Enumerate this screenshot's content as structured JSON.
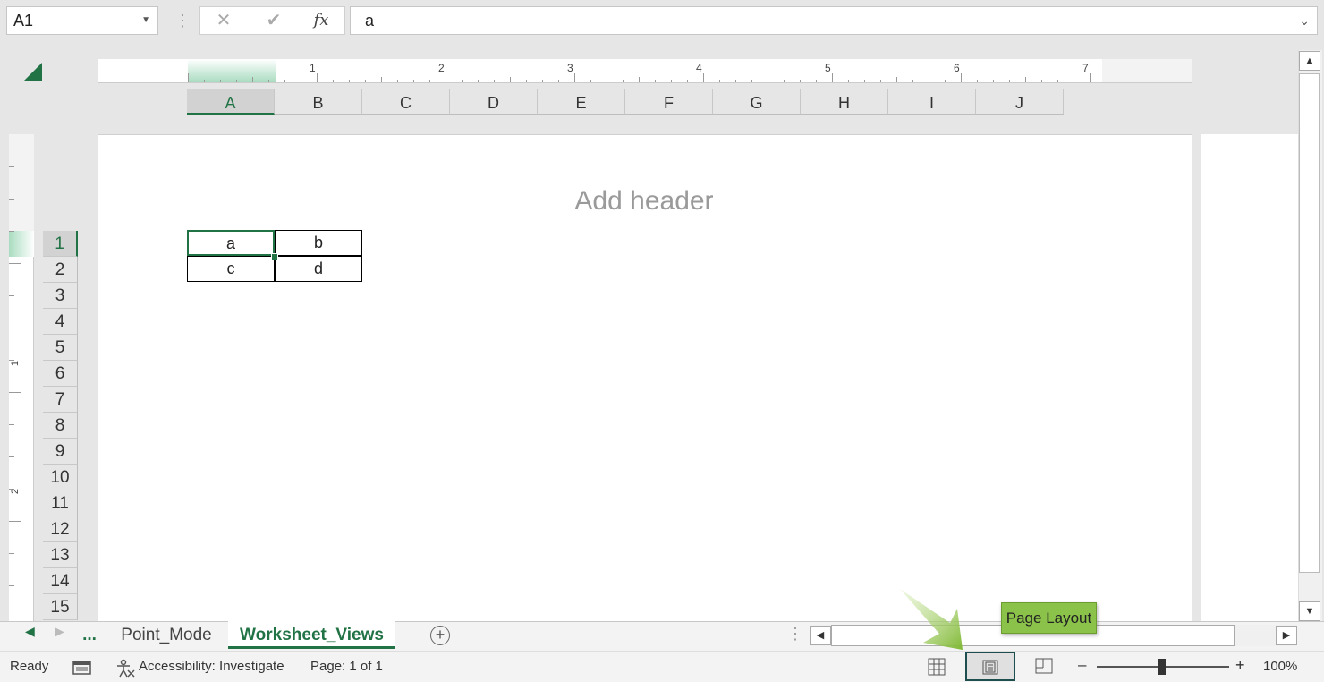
{
  "formula_bar": {
    "name_box": "A1",
    "formula_value": "a",
    "cancel_glyph": "✕",
    "enter_glyph": "✔",
    "fx_glyph": "fx"
  },
  "ruler": {
    "top_numbers": [
      "1",
      "2",
      "3",
      "4",
      "5",
      "6",
      "7"
    ],
    "left_numbers": [
      "1",
      "2"
    ]
  },
  "columns": [
    "A",
    "B",
    "C",
    "D",
    "E",
    "F",
    "G",
    "H",
    "I",
    "J"
  ],
  "rows": [
    "1",
    "2",
    "3",
    "4",
    "5",
    "6",
    "7",
    "8",
    "9",
    "10",
    "11",
    "12",
    "13",
    "14",
    "15"
  ],
  "page": {
    "header_placeholder": "Add header"
  },
  "cells": {
    "A1": "a",
    "B1": "b",
    "A2": "c",
    "B2": "d"
  },
  "sheet_tabs": {
    "ellipsis": "...",
    "tabs": [
      "Point_Mode",
      "Worksheet_Views"
    ],
    "active": "Worksheet_Views",
    "add_glyph": "+"
  },
  "status_bar": {
    "ready": "Ready",
    "accessibility": "Accessibility: Investigate",
    "page": "Page: 1 of 1",
    "zoom": "100%",
    "zoom_minus": "–",
    "zoom_plus": "+",
    "zoom_level_percent": 100
  },
  "tooltip": {
    "label": "Page Layout"
  },
  "colors": {
    "accent": "#217346",
    "tooltip": "#8bc34a"
  },
  "icons": [
    "cancel-icon",
    "enter-icon",
    "function-icon",
    "macro-icon",
    "accessibility-icon",
    "normal-view-icon",
    "page-layout-icon",
    "page-break-preview-icon",
    "add-sheet-icon",
    "scroll-left-icon",
    "scroll-right-icon",
    "scroll-up-icon",
    "scroll-down-icon"
  ]
}
